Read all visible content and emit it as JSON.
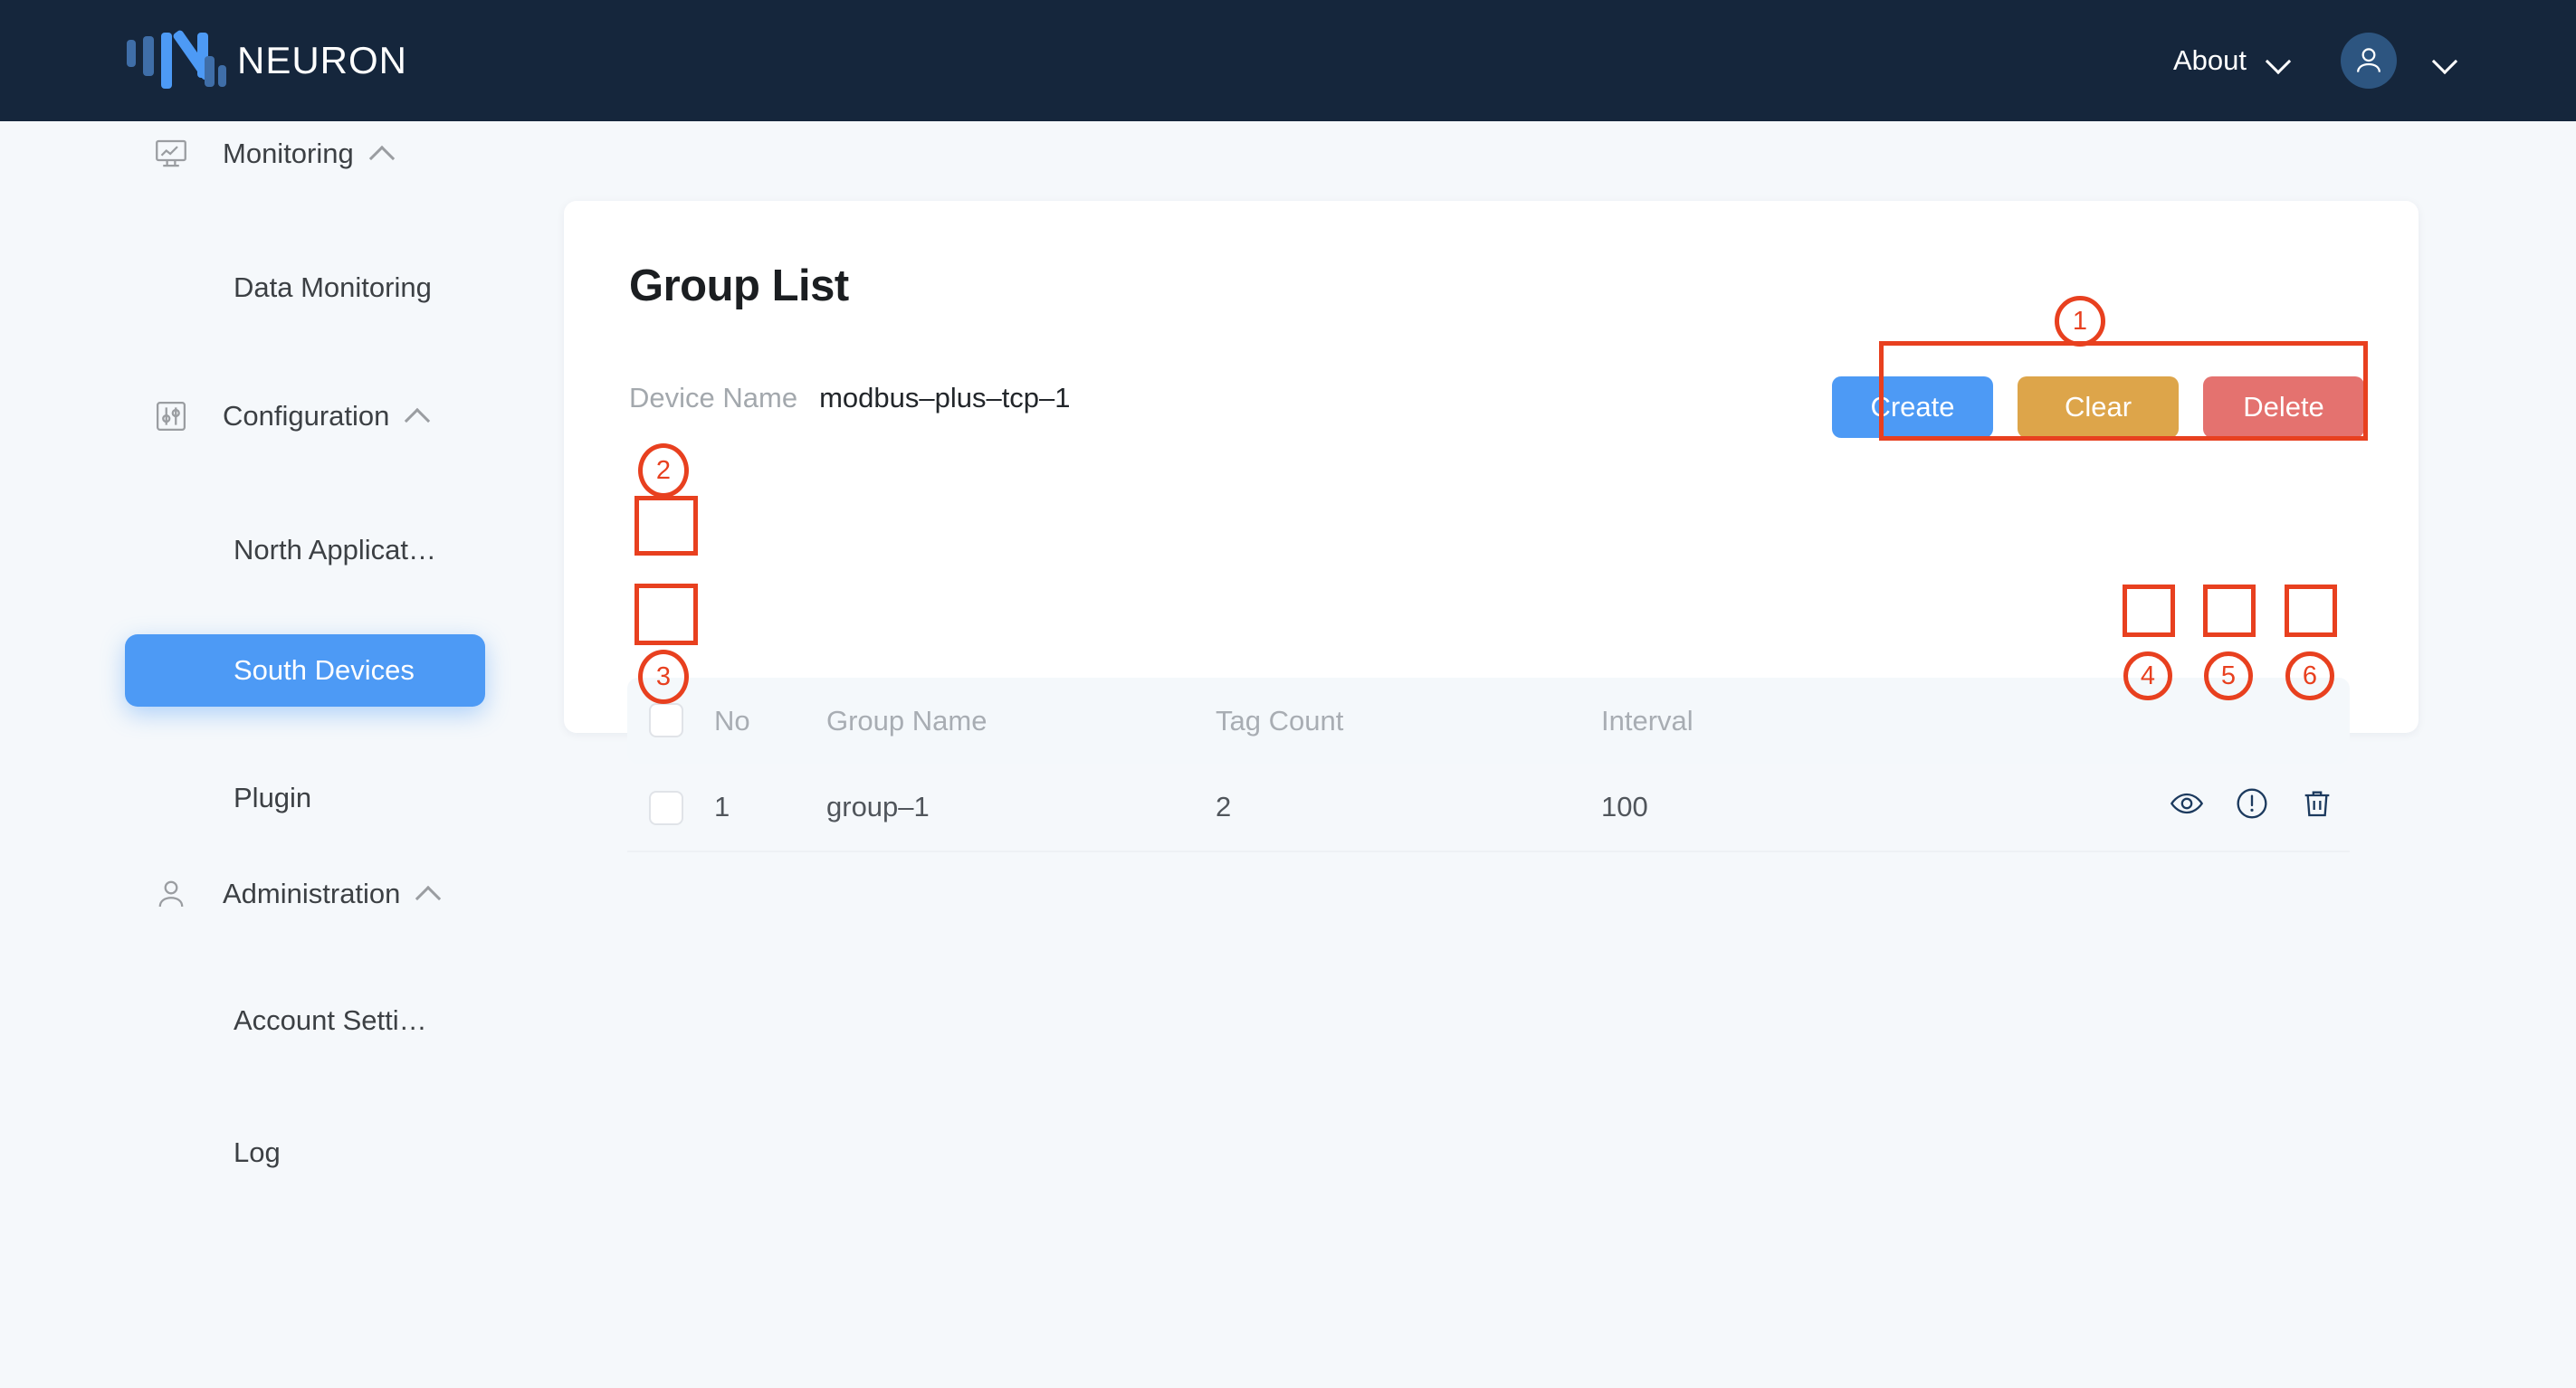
{
  "header": {
    "brand": "NEURON",
    "about_label": "About",
    "about_chevron_icon": "chevron-down-icon",
    "avatar_icon": "user-avatar-icon",
    "user_chevron_icon": "chevron-down-icon",
    "logo_icon": "neuron-logo-icon",
    "bg_color": "#15263c",
    "avatar_color": "#2d5580"
  },
  "sidebar": {
    "groups": [
      {
        "label": "Monitoring",
        "icon": "monitor-chart-icon",
        "chevron": "chevron-up-icon"
      },
      {
        "label": "Configuration",
        "icon": "sliders-icon",
        "chevron": "chevron-up-icon"
      },
      {
        "label": "Administration",
        "icon": "user-icon",
        "chevron": "chevron-up-icon"
      }
    ],
    "items": [
      {
        "label": "Data Monitoring",
        "active": false
      },
      {
        "label": "North Applicat…",
        "active": false
      },
      {
        "label": "South Devices",
        "active": true
      },
      {
        "label": "Plugin",
        "active": false
      },
      {
        "label": "Account Setti…",
        "active": false
      },
      {
        "label": "Log",
        "active": false
      }
    ],
    "active_color": "#4d9af5"
  },
  "main": {
    "title": "Group List",
    "device_label": "Device Name",
    "device_value": "modbus–plus–tcp–1",
    "buttons": [
      {
        "label": "Create",
        "color": "#4d9af5",
        "name": "create-button"
      },
      {
        "label": "Clear",
        "color": "#dda54a",
        "name": "clear-button"
      },
      {
        "label": "Delete",
        "color": "#e4726f",
        "name": "delete-button"
      }
    ],
    "table": {
      "columns": [
        "No",
        "Group Name",
        "Tag Count",
        "Interval"
      ],
      "rows": [
        {
          "no": "1",
          "group_name": "group–1",
          "tag_count": "2",
          "interval": "100"
        }
      ],
      "row_actions": [
        {
          "icon": "eye-icon",
          "name": "view-group-button"
        },
        {
          "icon": "alert-circle-icon",
          "name": "group-status-button"
        },
        {
          "icon": "trash-icon",
          "name": "delete-group-button"
        }
      ]
    }
  },
  "annotations": {
    "color": "#e8401f",
    "markers": [
      {
        "id": "1",
        "target": "action-buttons-group"
      },
      {
        "id": "2",
        "target": "select-all-checkbox"
      },
      {
        "id": "3",
        "target": "row-checkbox"
      },
      {
        "id": "4",
        "target": "view-group-button"
      },
      {
        "id": "5",
        "target": "group-status-button"
      },
      {
        "id": "6",
        "target": "delete-group-button"
      }
    ]
  }
}
